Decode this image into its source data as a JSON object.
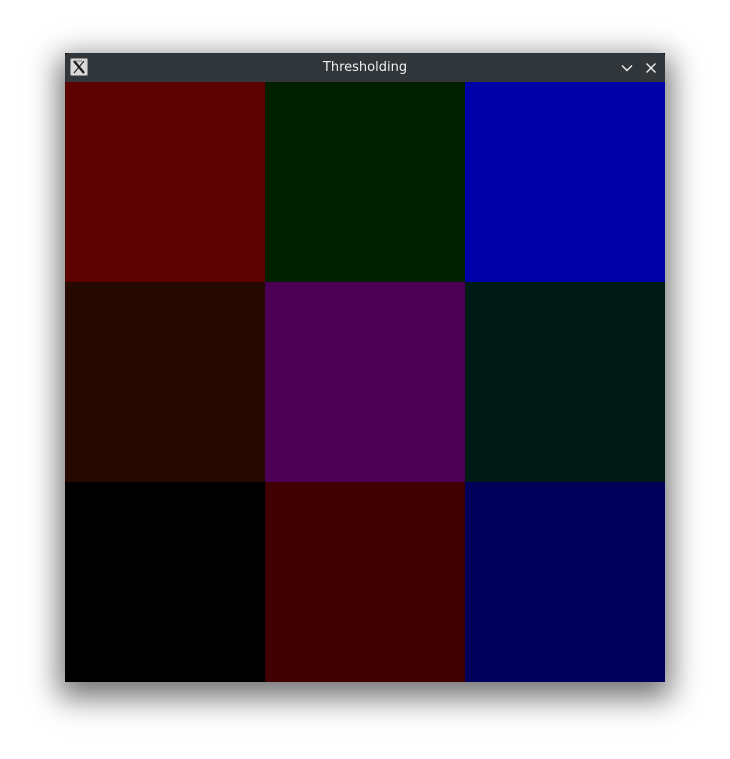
{
  "window": {
    "title": "Thresholding",
    "icons": {
      "app": "x-app-icon",
      "minimize": "chevron-down-icon",
      "close": "close-icon"
    }
  },
  "canvas": {
    "rows": 3,
    "cols": 3,
    "cells": [
      [
        "#5c0000",
        "#002000",
        "#0000a8"
      ],
      [
        "#250800",
        "#4b0055",
        "#001a16"
      ],
      [
        "#000000",
        "#3e0000",
        "#00005a"
      ]
    ]
  }
}
